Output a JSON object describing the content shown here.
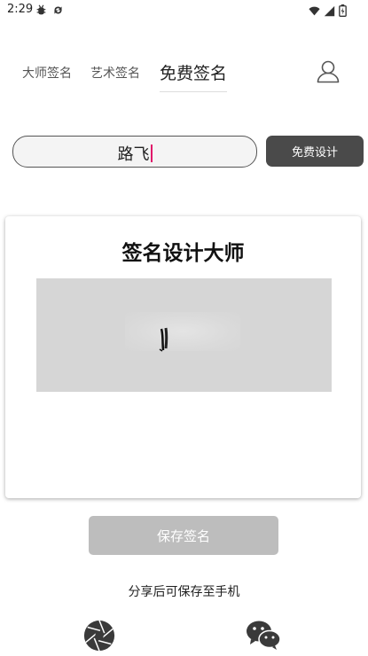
{
  "status_bar": {
    "time": "2:29",
    "left_icons": [
      "debug-icon",
      "sync-icon"
    ],
    "right_icons": [
      "wifi-icon",
      "signal-icon",
      "battery-icon"
    ]
  },
  "tabs": [
    {
      "label": "大师签名",
      "active": false
    },
    {
      "label": "艺术签名",
      "active": false
    },
    {
      "label": "免费签名",
      "active": true
    }
  ],
  "profile_icon": "user-icon",
  "search": {
    "value": "路飞",
    "button_label": "免费设计"
  },
  "card": {
    "title": "签名设计大师"
  },
  "save_label": "保存签名",
  "share_hint": "分享后可保存至手机",
  "share_icons": [
    "aperture-icon",
    "wechat-icon"
  ],
  "colors": {
    "accent_dark": "#4a4a4a",
    "disabled_button": "#bdbdbd",
    "caret": "#e0186a",
    "signature_bg": "#d6d6d6"
  }
}
